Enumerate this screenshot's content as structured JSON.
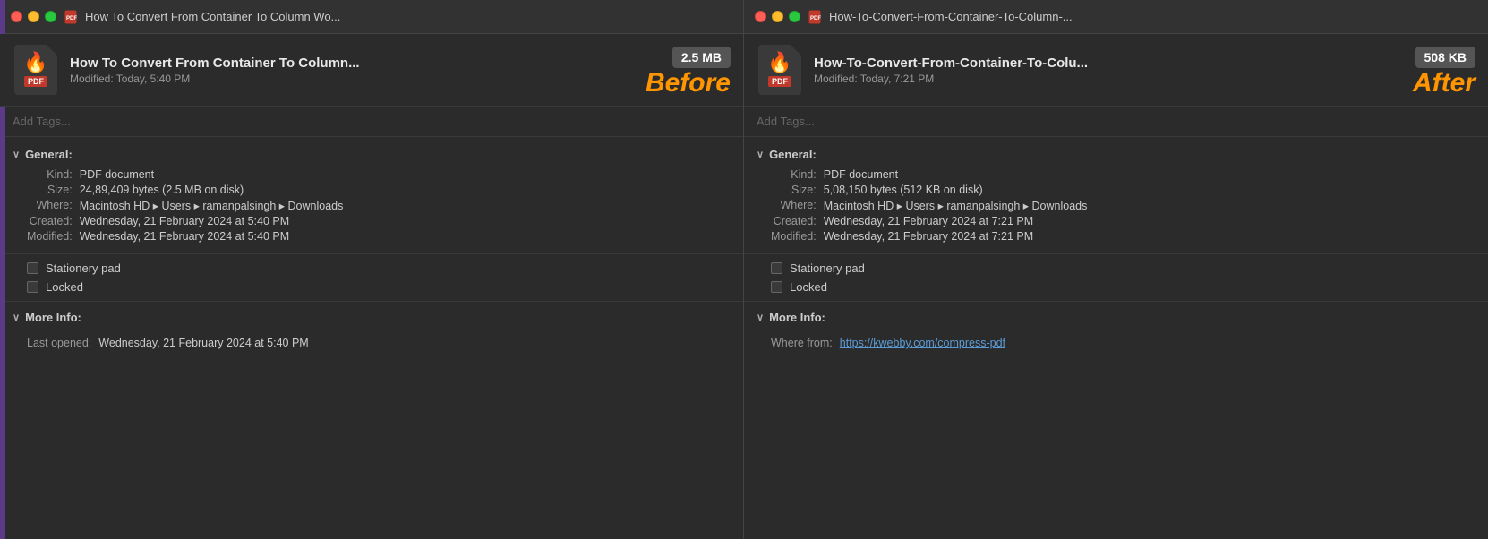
{
  "left": {
    "titleBar": {
      "text": "How To Convert From Container To Column Wo..."
    },
    "fileHeader": {
      "title": "How To Convert From Container To Column...",
      "modified": "Modified:  Today, 5:40 PM",
      "size": "2.5 MB"
    },
    "label": "Before",
    "tags": {
      "placeholder": "Add Tags..."
    },
    "general": {
      "header": "General:",
      "kind_label": "Kind:",
      "kind_value": "PDF document",
      "size_label": "Size:",
      "size_value": "24,89,409 bytes (2.5 MB on disk)",
      "where_label": "Where:",
      "where_value": "Macintosh HD ▸ Users ▸ ramanpalsingh ▸ Downloads",
      "created_label": "Created:",
      "created_value": "Wednesday, 21 February 2024 at 5:40 PM",
      "modified_label": "Modified:",
      "modified_value": "Wednesday, 21 February 2024 at 5:40 PM"
    },
    "checkboxes": {
      "stationery": "Stationery pad",
      "locked": "Locked"
    },
    "moreInfo": {
      "header": "More Info:",
      "lastOpened_label": "Last opened:",
      "lastOpened_value": "Wednesday, 21 February 2024 at 5:40 PM"
    }
  },
  "right": {
    "titleBar": {
      "text": "How-To-Convert-From-Container-To-Column-..."
    },
    "fileHeader": {
      "title": "How-To-Convert-From-Container-To-Colu...",
      "modified": "Modified:  Today, 7:21 PM",
      "size": "508 KB"
    },
    "label": "After",
    "tags": {
      "placeholder": "Add Tags..."
    },
    "general": {
      "header": "General:",
      "kind_label": "Kind:",
      "kind_value": "PDF document",
      "size_label": "Size:",
      "size_value": "5,08,150 bytes (512 KB on disk)",
      "where_label": "Where:",
      "where_value": "Macintosh HD ▸ Users ▸ ramanpalsingh ▸ Downloads",
      "created_label": "Created:",
      "created_value": "Wednesday, 21 February 2024 at 7:21 PM",
      "modified_label": "Modified:",
      "modified_value": "Wednesday, 21 February 2024 at 7:21 PM"
    },
    "checkboxes": {
      "stationery": "Stationery pad",
      "locked": "Locked"
    },
    "moreInfo": {
      "header": "More Info:",
      "whereFrom_label": "Where from:",
      "whereFrom_value": "https://kwebby.com/compress-pdf"
    }
  },
  "icons": {
    "pdf_flame": "🔥",
    "pdf_badge": "PDF",
    "chevron_down": "∨"
  }
}
